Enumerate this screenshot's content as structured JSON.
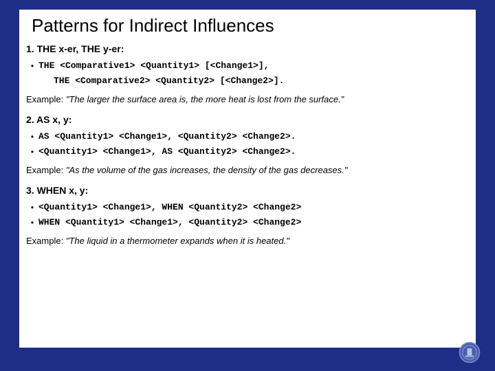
{
  "title": "Patterns for Indirect Influences",
  "sections": [
    {
      "head": "1. THE x-er, THE y-er:",
      "bullets": [
        "THE <Comparative1> <Quantity1> [<Change1>],"
      ],
      "indent_line": "THE <Comparative2> <Quantity2> [<Change2>].",
      "example_label": "Example: ",
      "example_text": "\"The larger the surface area is, the more heat is lost from the surface.\""
    },
    {
      "head": "2. AS x, y:",
      "bullets": [
        "AS <Quantity1> <Change1>, <Quantity2> <Change2>.",
        "<Quantity1> <Change1>, AS <Quantity2> <Change2>."
      ],
      "indent_line": null,
      "example_label": "Example: ",
      "example_text": "\"As the volume of the gas increases, the density of the gas decreases.\""
    },
    {
      "head": "3. WHEN x, y:",
      "bullets": [
        "<Quantity1> <Change1>, WHEN <Quantity2> <Change2>",
        "WHEN <Quantity1> <Change1>, <Quantity2> <Change2>"
      ],
      "indent_line": null,
      "example_label": "Example: ",
      "example_text": "\"The liquid in a thermometer expands when it is heated.\""
    }
  ]
}
